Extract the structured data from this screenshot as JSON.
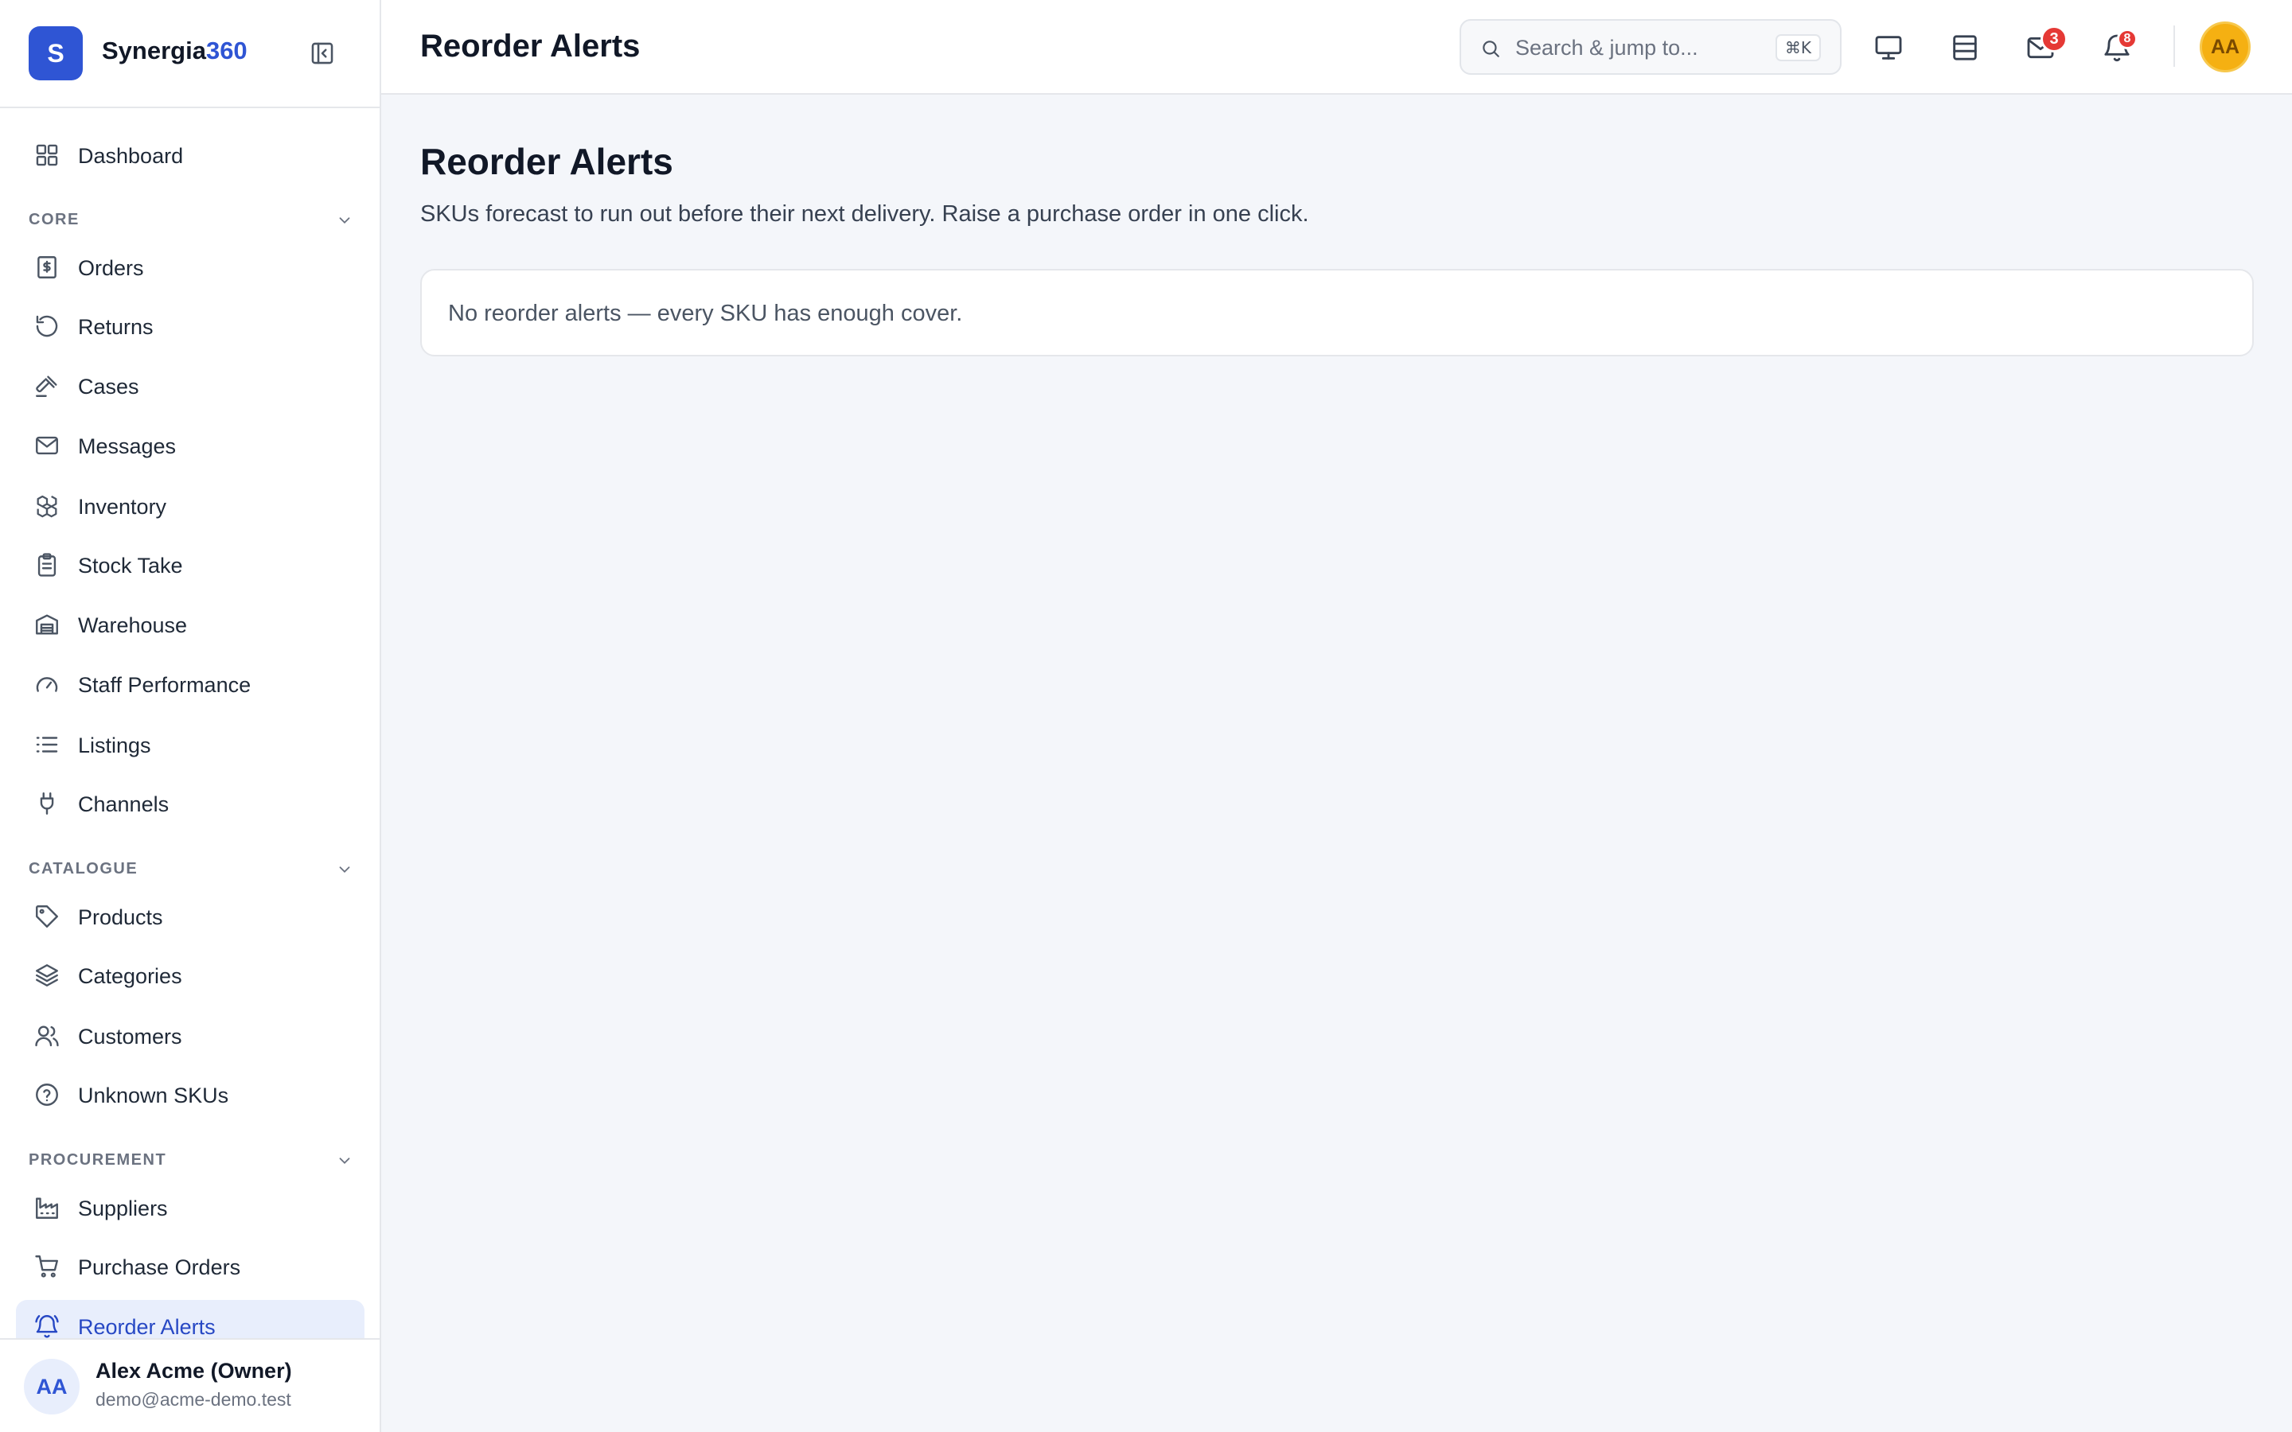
{
  "brand": {
    "logo_letter": "S",
    "name_primary": "Synergia",
    "name_accent": "360"
  },
  "sidebar": {
    "dashboard": {
      "label": "Dashboard",
      "icon": "grid-icon"
    },
    "sections": [
      {
        "title": "CORE"
      },
      {
        "title": "CATALOGUE"
      },
      {
        "title": "PROCUREMENT"
      }
    ],
    "core_items": [
      {
        "label": "Orders",
        "icon": "receipt-icon"
      },
      {
        "label": "Returns",
        "icon": "rotate-ccw-icon"
      },
      {
        "label": "Cases",
        "icon": "gavel-icon"
      },
      {
        "label": "Messages",
        "icon": "mail-icon"
      },
      {
        "label": "Inventory",
        "icon": "boxes-icon"
      },
      {
        "label": "Stock Take",
        "icon": "clipboard-icon"
      },
      {
        "label": "Warehouse",
        "icon": "warehouse-icon"
      },
      {
        "label": "Staff Performance",
        "icon": "gauge-icon"
      },
      {
        "label": "Listings",
        "icon": "list-icon"
      },
      {
        "label": "Channels",
        "icon": "plug-icon"
      }
    ],
    "catalogue_items": [
      {
        "label": "Products",
        "icon": "tag-icon"
      },
      {
        "label": "Categories",
        "icon": "layers-icon"
      },
      {
        "label": "Customers",
        "icon": "users-icon"
      },
      {
        "label": "Unknown SKUs",
        "icon": "help-circle-icon"
      }
    ],
    "procurement_items": [
      {
        "label": "Suppliers",
        "icon": "factory-icon"
      },
      {
        "label": "Purchase Orders",
        "icon": "cart-icon"
      },
      {
        "label": "Reorder Alerts",
        "icon": "bell-ring-icon",
        "active": true
      }
    ]
  },
  "user": {
    "initials": "AA",
    "name": "Alex Acme (Owner)",
    "email": "demo@acme-demo.test"
  },
  "topbar": {
    "title": "Reorder Alerts",
    "search_placeholder": "Search & jump to...",
    "search_shortcut": "⌘K",
    "icons": [
      "monitor-icon",
      "panel-icon",
      "inbox-icon",
      "bell-icon"
    ],
    "inbox_badge": "3",
    "bell_badge": "8",
    "avatar_initials": "AA"
  },
  "main": {
    "title": "Reorder Alerts",
    "subtitle": "SKUs forecast to run out before their next delivery. Raise a purchase order in one click.",
    "empty_message": "No reorder alerts — every SKU has enough cover."
  },
  "colors": {
    "accent": "#2f55d4",
    "active_bg": "#e8eefc",
    "badge": "#e53935",
    "avatar": "#f5b012",
    "page_bg": "#f4f6fa"
  }
}
